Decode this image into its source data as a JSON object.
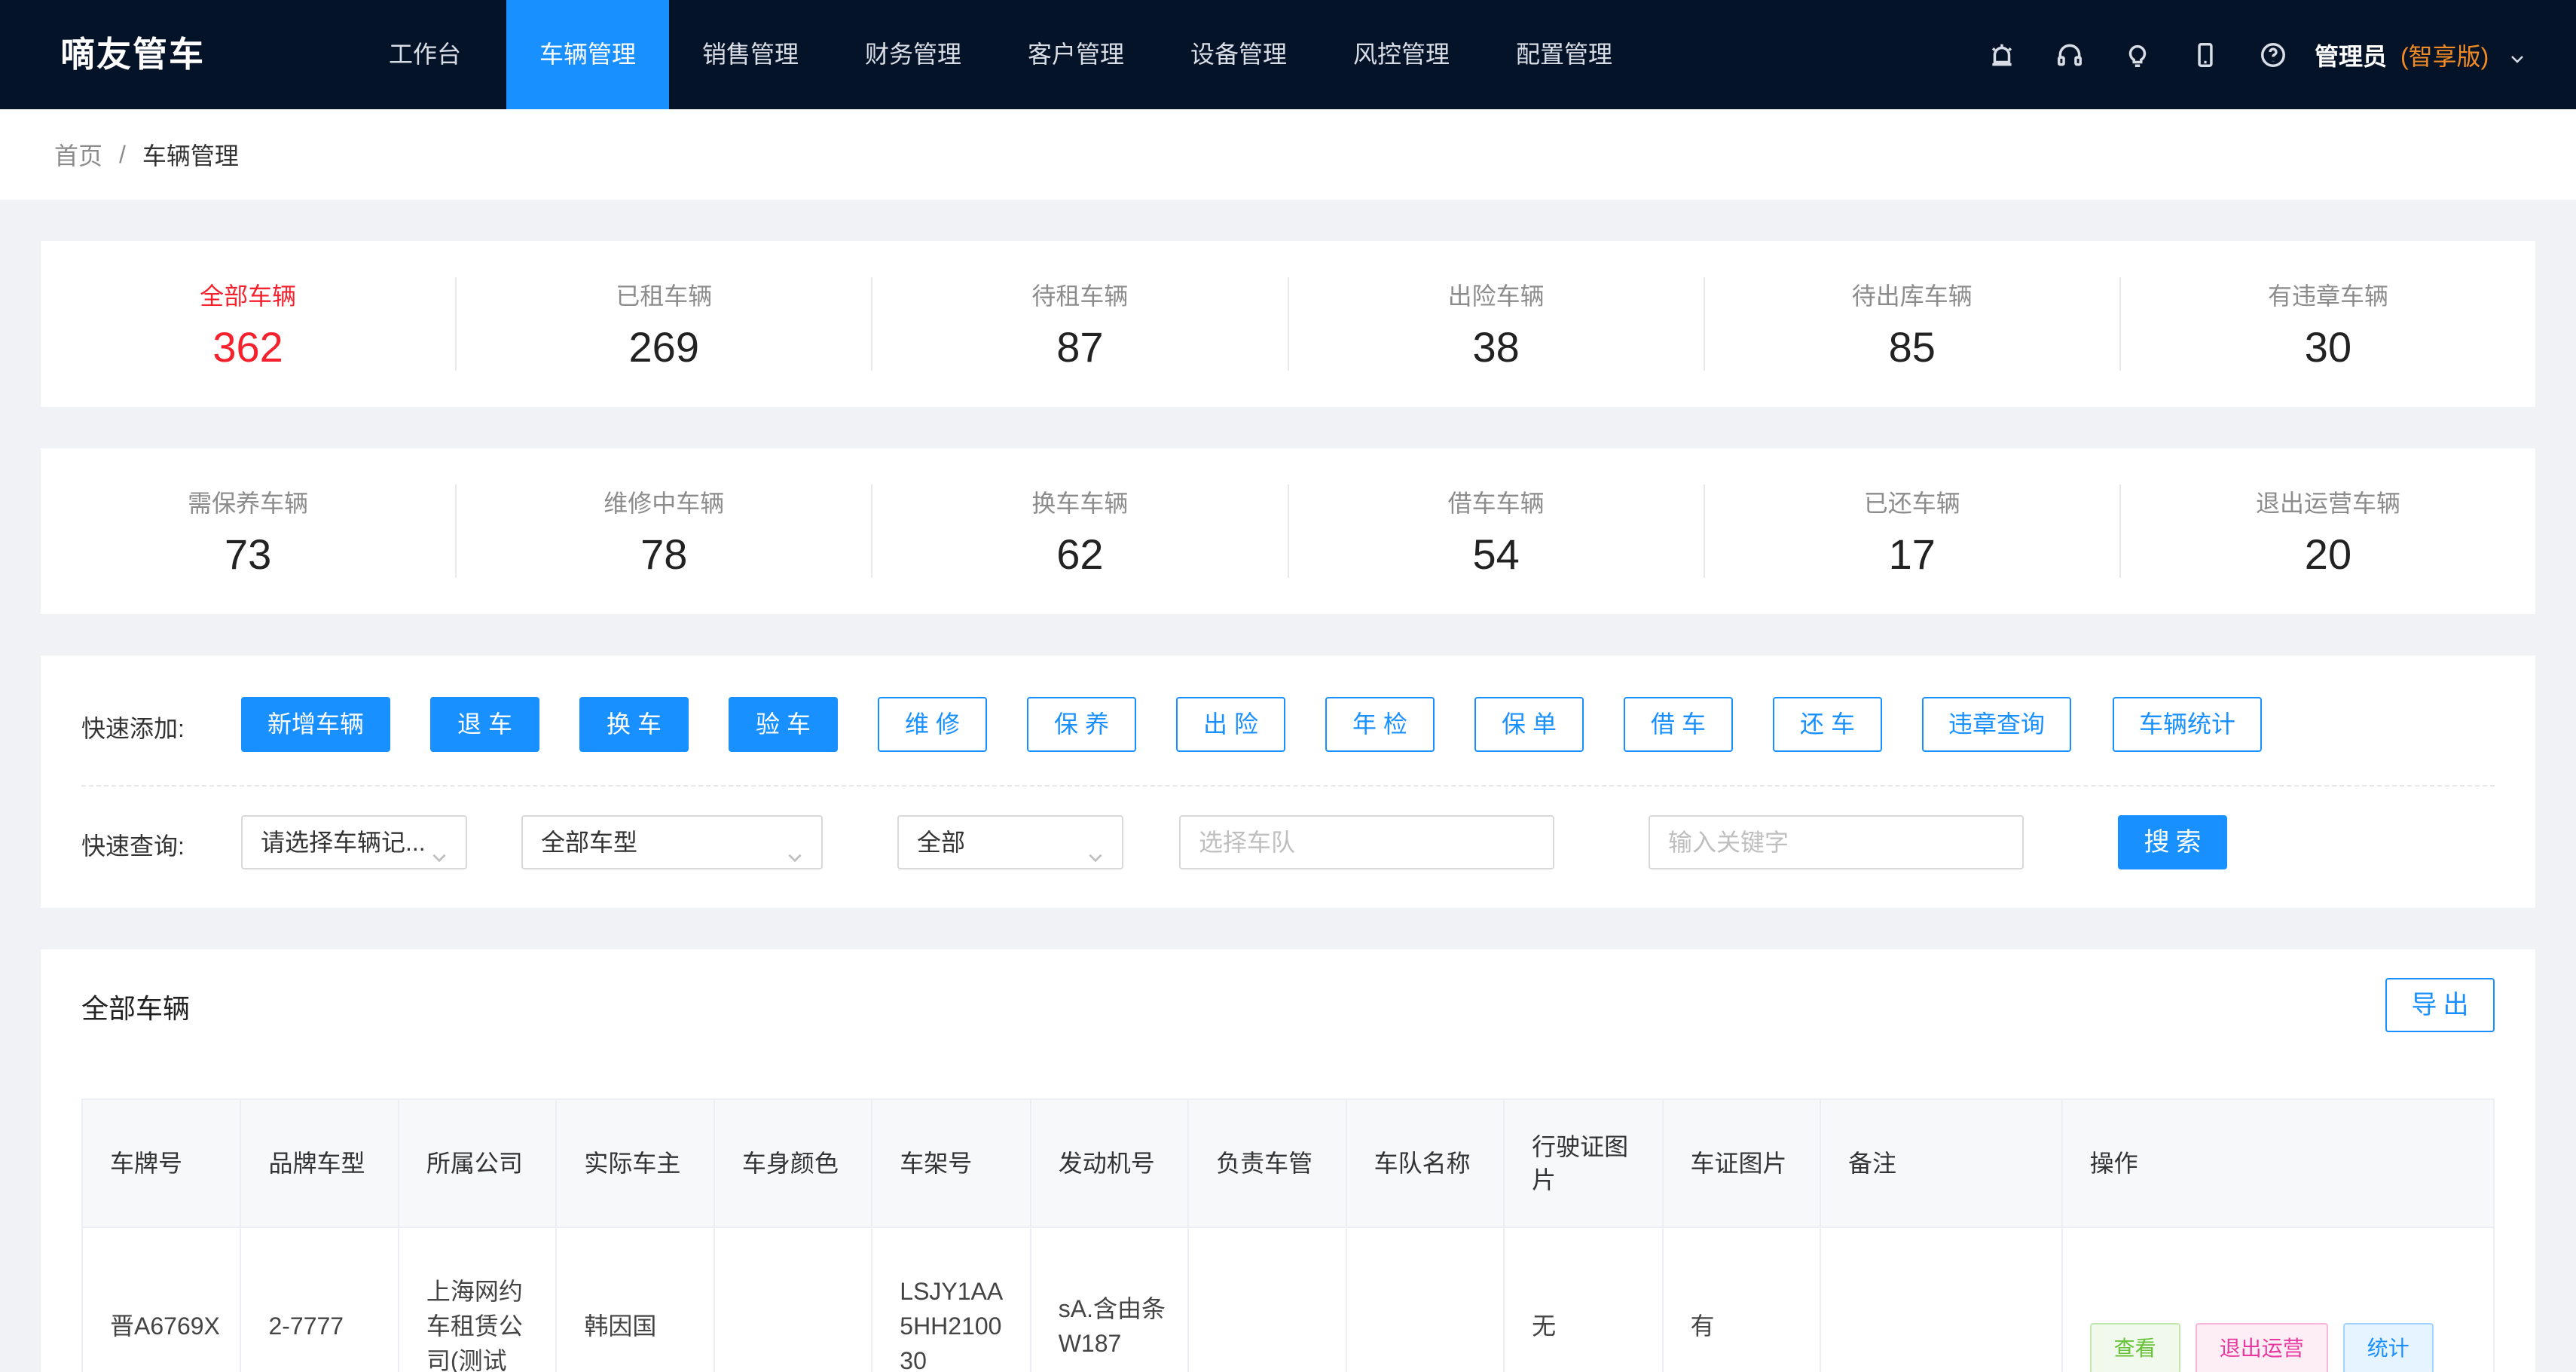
{
  "app": {
    "logo": "嘀友管车"
  },
  "menu": [
    "工作台",
    "车辆管理",
    "销售管理",
    "财务管理",
    "客户管理",
    "设备管理",
    "风控管理",
    "配置管理"
  ],
  "user": {
    "name": "管理员",
    "edition": "(智享版)"
  },
  "breadcrumb": {
    "home": "首页",
    "sep": "/",
    "current": "车辆管理"
  },
  "stats_row1": [
    {
      "label": "全部车辆",
      "value": "362"
    },
    {
      "label": "已租车辆",
      "value": "269"
    },
    {
      "label": "待租车辆",
      "value": "87"
    },
    {
      "label": "出险车辆",
      "value": "38"
    },
    {
      "label": "待出库车辆",
      "value": "85"
    },
    {
      "label": "有违章车辆",
      "value": "30"
    }
  ],
  "stats_row2": [
    {
      "label": "需保养车辆",
      "value": "73"
    },
    {
      "label": "维修中车辆",
      "value": "78"
    },
    {
      "label": "换车车辆",
      "value": "62"
    },
    {
      "label": "借车车辆",
      "value": "54"
    },
    {
      "label": "已还车辆",
      "value": "17"
    },
    {
      "label": "退出运营车辆",
      "value": "20"
    }
  ],
  "quick_add": {
    "label": "快速添加:",
    "buttons": [
      "新增车辆",
      "退 车",
      "换 车",
      "验 车",
      "维 修",
      "保 养",
      "出 险",
      "年 检",
      "保 单",
      "借 车",
      "还 车",
      "违章查询",
      "车辆统计"
    ]
  },
  "quick_search": {
    "label": "快速查询:",
    "record_select": "请选择车辆记...",
    "model_select": "全部车型",
    "status_select": "全部",
    "team_placeholder": "选择车队",
    "keyword_placeholder": "输入关键字",
    "search_label": "搜索"
  },
  "table": {
    "title": "全部车辆",
    "export_label": "导出",
    "columns": [
      "车牌号",
      "品牌车型",
      "所属公司",
      "实际车主",
      "车身颜色",
      "车架号",
      "发动机号",
      "负责车管",
      "车队名称",
      "行驶证图片",
      "车证图片",
      "备注",
      "操作"
    ],
    "rows": [
      [
        "晋A6769X",
        "2-7777",
        "上海网约车租赁公司(测试",
        "韩因国",
        "",
        "LSJY1AA5HH210030",
        "sA.含由条W187",
        "",
        "",
        "无",
        "有",
        ""
      ]
    ],
    "actions": [
      "查看",
      "退出运营",
      "统计"
    ]
  },
  "colors": {
    "accent": "#1890ff",
    "nav_bg": "#051329",
    "highlight": "#f5222d",
    "edition": "#f08a24"
  }
}
